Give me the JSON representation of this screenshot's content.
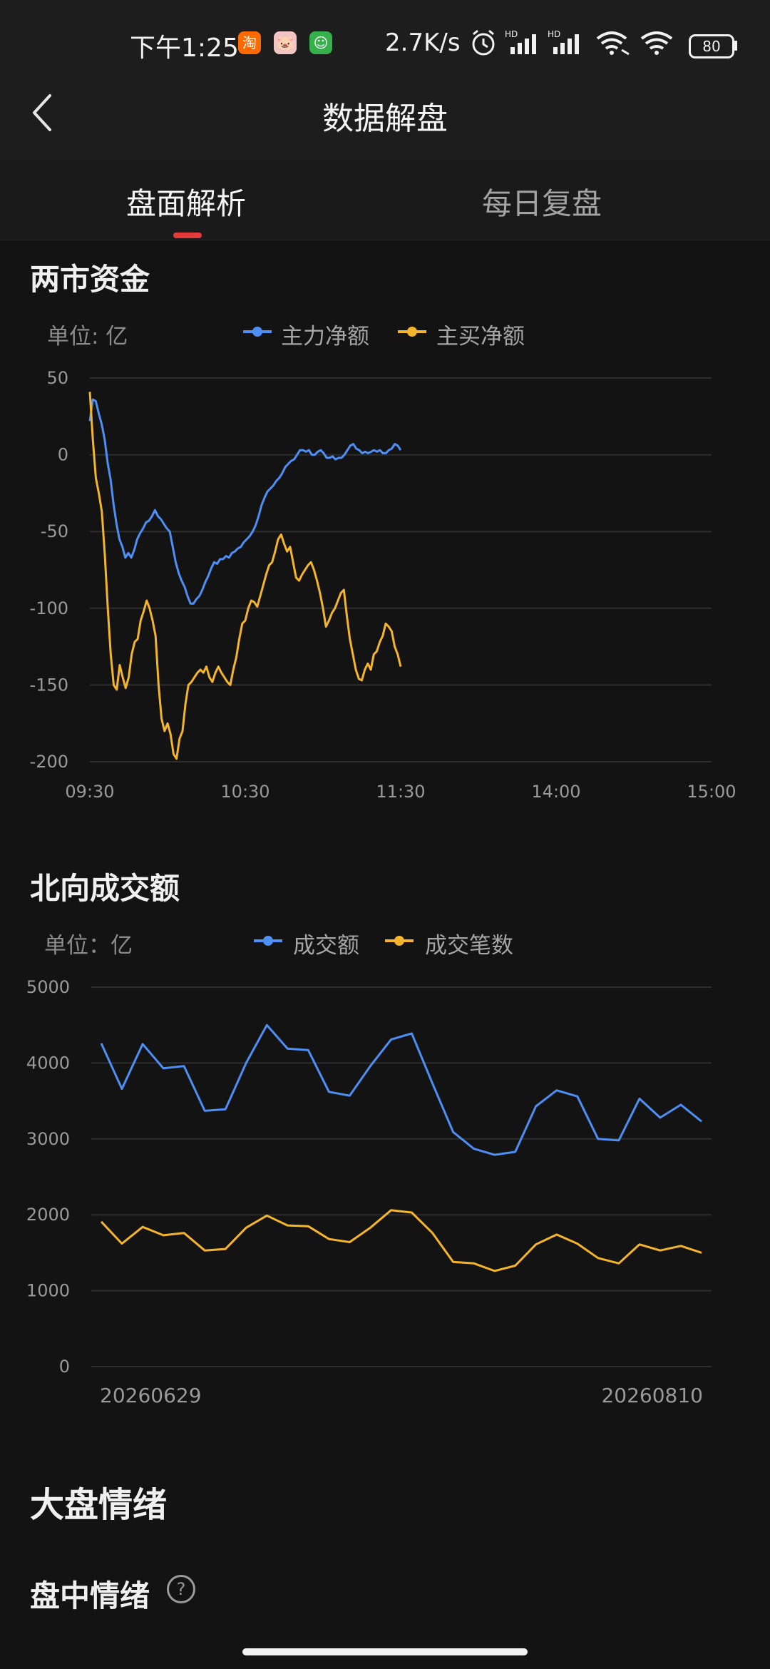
{
  "status_bar": {
    "time": "下午1:25",
    "app_badges": [
      {
        "name": "taobao-badge-icon",
        "glyph": "淘",
        "color": "#ff6a00"
      },
      {
        "name": "pig-app-badge-icon",
        "glyph": "🐷",
        "color": "#f2c4c4"
      },
      {
        "name": "green-app-badge-icon",
        "glyph": "☺",
        "color": "#35b04a"
      }
    ],
    "network_speed": "2.7K/s",
    "hd_label_1": "HD",
    "hd_label_2": "HD",
    "battery": "80"
  },
  "nav": {
    "title": "数据解盘"
  },
  "tabs": [
    {
      "label": "盘面解析",
      "active": true
    },
    {
      "label": "每日复盘",
      "active": false
    }
  ],
  "section1": {
    "title": "两市资金",
    "unit": "单位: 亿",
    "legend": [
      {
        "label": "主力净额",
        "color": "#4e8ff5"
      },
      {
        "label": "主买净额",
        "color": "#f5b52b"
      }
    ]
  },
  "section2": {
    "title": "北向成交额",
    "unit": "单位：亿",
    "legend": [
      {
        "label": "成交额",
        "color": "#4e8ff5"
      },
      {
        "label": "成交笔数",
        "color": "#f5b52b"
      }
    ]
  },
  "section3": {
    "title": "大盘情绪",
    "subtitle": "盘中情绪",
    "help_glyph": "?"
  },
  "chart_data": [
    {
      "type": "line",
      "title": "两市资金",
      "y_ticks": [
        "50",
        "0",
        "-50",
        "-100",
        "-150",
        "-200"
      ],
      "x_ticks": [
        "09:30",
        "10:30",
        "11:30",
        "14:00",
        "15:00"
      ],
      "ylim": [
        -200,
        50
      ],
      "series": [
        {
          "name": "主力净额",
          "color": "#4e8ff5",
          "values": [
            22,
            36,
            35,
            27,
            20,
            10,
            -5,
            -16,
            -32,
            -45,
            -55,
            -60,
            -67,
            -64,
            -67,
            -62,
            -55,
            -51,
            -48,
            -44,
            -43,
            -40,
            -36,
            -40,
            -42,
            -45,
            -48,
            -50,
            -60,
            -70,
            -77,
            -82,
            -86,
            -92,
            -97,
            -97,
            -94,
            -92,
            -88,
            -83,
            -79,
            -74,
            -70,
            -71,
            -68,
            -68,
            -66,
            -67,
            -64,
            -63,
            -61,
            -60,
            -57,
            -55,
            -53,
            -50,
            -46,
            -40,
            -33,
            -28,
            -24,
            -22,
            -20,
            -17,
            -15,
            -12,
            -8,
            -6,
            -4,
            -3,
            0,
            3,
            3,
            2,
            3,
            0,
            0,
            2,
            3,
            1,
            -2,
            -2,
            -1,
            -3,
            -2,
            -2,
            0,
            3,
            6,
            7,
            4,
            3,
            1,
            2,
            1,
            2,
            3,
            2,
            3,
            1,
            1,
            3,
            4,
            7,
            6,
            3
          ]
        },
        {
          "name": "主买净额",
          "color": "#f5b52b",
          "values": [
            41,
            10,
            -15,
            -25,
            -37,
            -65,
            -100,
            -130,
            -150,
            -153,
            -137,
            -145,
            -152,
            -145,
            -130,
            -122,
            -120,
            -108,
            -102,
            -95,
            -100,
            -108,
            -118,
            -150,
            -172,
            -180,
            -175,
            -182,
            -195,
            -198,
            -185,
            -180,
            -162,
            -150,
            -148,
            -145,
            -142,
            -140,
            -142,
            -138,
            -145,
            -148,
            -142,
            -138,
            -142,
            -145,
            -148,
            -150,
            -140,
            -132,
            -120,
            -110,
            -108,
            -100,
            -95,
            -96,
            -99,
            -92,
            -85,
            -78,
            -72,
            -70,
            -63,
            -55,
            -52,
            -58,
            -63,
            -60,
            -70,
            -80,
            -82,
            -78,
            -75,
            -72,
            -70,
            -75,
            -82,
            -90,
            -100,
            -112,
            -108,
            -103,
            -100,
            -95,
            -90,
            -88,
            -105,
            -120,
            -130,
            -140,
            -146,
            -147,
            -140,
            -136,
            -140,
            -130,
            -128,
            -122,
            -118,
            -110,
            -112,
            -115,
            -125,
            -130,
            -138
          ]
        }
      ]
    },
    {
      "type": "line",
      "title": "北向成交额",
      "y_ticks": [
        "5000",
        "4000",
        "3000",
        "2000",
        "1000",
        "0"
      ],
      "x_ticks": [
        "20260629",
        "20260810"
      ],
      "ylim": [
        0,
        5000
      ],
      "series": [
        {
          "name": "成交额",
          "color": "#4e8ff5",
          "values": [
            4260,
            3660,
            4250,
            3930,
            3960,
            3370,
            3390,
            4000,
            4500,
            4190,
            4170,
            3620,
            3570,
            3960,
            4310,
            4390,
            3730,
            3090,
            2870,
            2790,
            2830,
            3430,
            3640,
            3560,
            3000,
            2980,
            3530,
            3280,
            3450,
            3230
          ]
        },
        {
          "name": "成交笔数",
          "color": "#f5b52b",
          "values": [
            1910,
            1620,
            1840,
            1730,
            1760,
            1530,
            1550,
            1830,
            1990,
            1860,
            1850,
            1680,
            1640,
            1830,
            2060,
            2030,
            1760,
            1380,
            1360,
            1260,
            1330,
            1610,
            1740,
            1620,
            1430,
            1360,
            1610,
            1530,
            1590,
            1500
          ]
        }
      ]
    }
  ]
}
